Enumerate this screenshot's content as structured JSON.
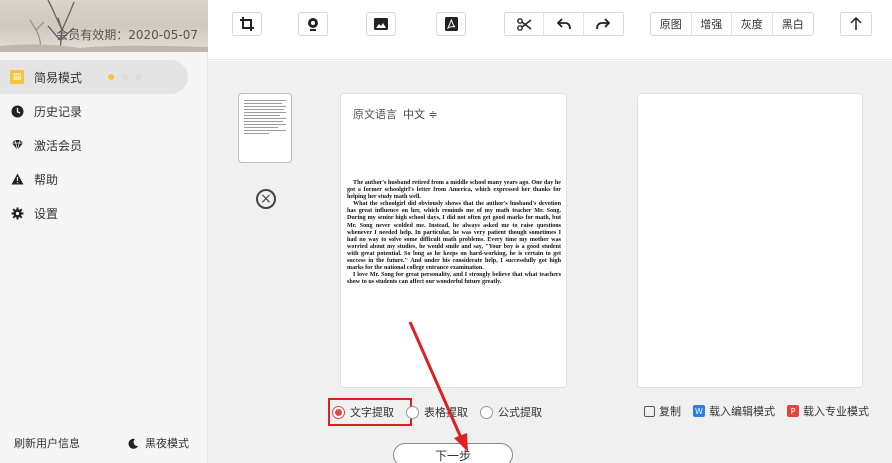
{
  "sidebar": {
    "member_expiry": "会员有效期：2020-05-07",
    "items": [
      {
        "label": "简易模式",
        "icon": "document-icon",
        "active": true
      },
      {
        "label": "历史记录",
        "icon": "clock-icon"
      },
      {
        "label": "激活会员",
        "icon": "diamond-icon"
      },
      {
        "label": "帮助",
        "icon": "warning-icon"
      },
      {
        "label": "设置",
        "icon": "gear-icon"
      }
    ],
    "mode_dot_colors": [
      "#f5c43b",
      "#dddddd",
      "#dddddd"
    ],
    "refresh_label": "刷新用户信息",
    "dark_mode_label": "黑夜模式"
  },
  "toolbar": {
    "icons": [
      "crop-icon",
      "camera-icon",
      "image-icon",
      "pdf-icon",
      "cut-icon",
      "undo-icon",
      "redo-icon"
    ],
    "filters": [
      "原图",
      "增强",
      "灰度",
      "黑白"
    ],
    "upload_icon": "upload-arrow-icon"
  },
  "source": {
    "language_label": "原文语言",
    "language_value": "中文 ≑"
  },
  "document": {
    "paragraphs": [
      "The author's husband retired from a middle school many years ago. One day he got a former schoolgirl's letter from America, which expressed her thanks for helping her study math well.",
      "What the schoolgirl did obviously shows that the author's husband's devotion has great influence on her, which reminds me of my math teacher Mr. Song. During my senior high school days, I did not often get good marks for math, but Mr. Song never scolded me. Instead, he always asked me to raise questions whenever I needed help. In particular, he was very patient though sometimes I had no way to solve some difficult math problems. Every time my mother was worried about my studies, he would smile and say, \"Your boy is a good student with great potential. So long as he keeps on hard-working, he is certain to get success in the future.\" And under his considerate help, I successfully got high marks for the national college entrance examination.",
      "I love Mr. Song for great personality, and I strongly believe that what teachers show to us students can affect our wonderful future greatly."
    ]
  },
  "options": {
    "items": [
      {
        "label": "文字提取",
        "checked": true
      },
      {
        "label": "表格提取",
        "checked": false
      },
      {
        "label": "公式提取",
        "checked": false
      }
    ]
  },
  "actions": {
    "copy": "复制",
    "load_editor": "载入编辑模式",
    "load_pro": "载入专业模式"
  },
  "next_button": "下一步",
  "colors": {
    "accent_red": "#e02020",
    "radio_red": "#e04848",
    "word_blue": "#2b7de9",
    "pdf_red": "#e2453a"
  }
}
